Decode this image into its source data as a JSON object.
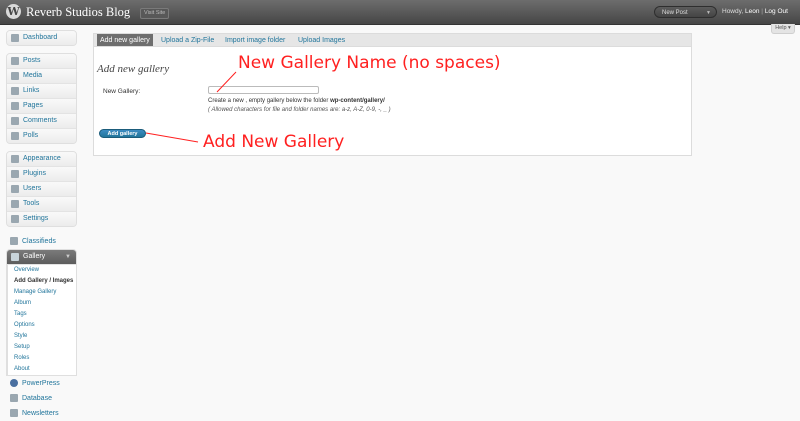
{
  "header": {
    "site_title": "Reverb Studios Blog",
    "visit_site": "Visit Site",
    "new_post": "New Post",
    "howdy_prefix": "Howdy,",
    "user": "Leon",
    "separator": "|",
    "logout": "Log Out",
    "help": "Help"
  },
  "sidebar": {
    "group1": [
      {
        "label": "Dashboard",
        "icon": "dashboard-icon"
      }
    ],
    "group2": [
      {
        "label": "Posts",
        "icon": "posts-icon"
      },
      {
        "label": "Media",
        "icon": "media-icon"
      },
      {
        "label": "Links",
        "icon": "links-icon"
      },
      {
        "label": "Pages",
        "icon": "pages-icon"
      },
      {
        "label": "Comments",
        "icon": "comments-icon"
      },
      {
        "label": "Polls",
        "icon": "polls-icon"
      }
    ],
    "group3": [
      {
        "label": "Appearance",
        "icon": "appearance-icon"
      },
      {
        "label": "Plugins",
        "icon": "plugins-icon"
      },
      {
        "label": "Users",
        "icon": "users-icon"
      },
      {
        "label": "Tools",
        "icon": "tools-icon"
      },
      {
        "label": "Settings",
        "icon": "settings-icon"
      }
    ],
    "classifieds": "Classifieds",
    "gallery": "Gallery",
    "gallery_sub": [
      "Overview",
      "Add Gallery / Images",
      "Manage Gallery",
      "Album",
      "Tags",
      "Options",
      "Style",
      "Setup",
      "Roles",
      "About"
    ],
    "bottom": [
      {
        "label": "PowerPress",
        "icon": "powerpress-icon"
      },
      {
        "label": "Database",
        "icon": "database-icon"
      },
      {
        "label": "Newsletters",
        "icon": "newsletters-icon"
      }
    ]
  },
  "tabs": [
    "Add new gallery",
    "Upload a Zip-File",
    "Import image folder",
    "Upload Images"
  ],
  "form": {
    "title": "Add new gallery",
    "label": "New Gallery:",
    "value": "",
    "desc_prefix": "Create a new , empty gallery below the folder",
    "desc_path": "wp-content/gallery/",
    "allowed": "( Allowed characters for file and folder names are: a-z, A-Z, 0-9, -, _ )",
    "button": "Add gallery"
  },
  "annotations": {
    "name_hint": "New Gallery Name (no spaces)",
    "add_hint": "Add New Gallery",
    "color": "#ff2020"
  },
  "colors": {
    "link": "#21759b",
    "header": "#464646",
    "button": "#21759b"
  }
}
